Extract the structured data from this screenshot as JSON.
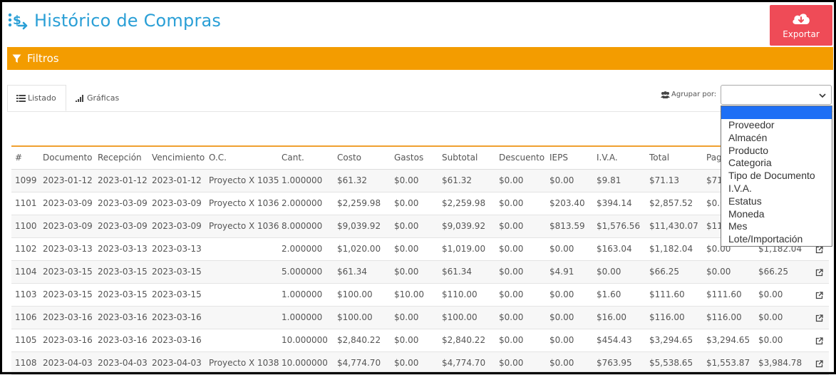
{
  "header": {
    "title": "Histórico de Compras",
    "export_label": "Exportar"
  },
  "filters": {
    "label": "Filtros"
  },
  "tabs": [
    {
      "label": "Listado"
    },
    {
      "label": "Gráficas"
    }
  ],
  "group_by": {
    "label": "Agrupar por:",
    "selected": "",
    "options": [
      "",
      "Proveedor",
      "Almacén",
      "Producto",
      "Categoria",
      "Tipo de Documento",
      "I.V.A.",
      "Estatus",
      "Moneda",
      "Mes",
      "Lote/Importación"
    ]
  },
  "table": {
    "columns": [
      "#",
      "Documento",
      "Recepción",
      "Vencimiento",
      "O.C.",
      "Cant.",
      "Costo",
      "Gastos",
      "Subtotal",
      "Descuento",
      "IEPS",
      "I.V.A.",
      "Total",
      "Pag",
      ""
    ],
    "rows": [
      [
        "1099",
        "2023-01-12",
        "2023-01-12",
        "2023-01-12",
        "Proyecto X 1035",
        "1.000000",
        "$61.32",
        "$0.00",
        "$61.32",
        "$0.00",
        "$0.00",
        "$9.81",
        "$71.13",
        "$71",
        ""
      ],
      [
        "1101",
        "2023-03-09",
        "2023-03-09",
        "2023-03-09",
        "Proyecto X 1036",
        "2.000000",
        "$2,259.98",
        "$0.00",
        "$2,259.98",
        "$0.00",
        "$203.40",
        "$394.14",
        "$2,857.52",
        "$0.0",
        ""
      ],
      [
        "1100",
        "2023-03-09",
        "2023-03-09",
        "2023-03-09",
        "Proyecto X 1036",
        "8.000000",
        "$9,039.92",
        "$0.00",
        "$9,039.92",
        "$0.00",
        "$813.59",
        "$1,576.56",
        "$11,430.07",
        "$11",
        ""
      ],
      [
        "1102",
        "2023-03-13",
        "2023-03-13",
        "2023-03-13",
        "",
        "2.000000",
        "$1,020.00",
        "$0.00",
        "$1,019.00",
        "$0.00",
        "$0.00",
        "$163.04",
        "$1,182.04",
        "$0.00",
        "$1,182.04"
      ],
      [
        "1104",
        "2023-03-15",
        "2023-03-15",
        "2023-03-15",
        "",
        "5.000000",
        "$61.34",
        "$0.00",
        "$61.34",
        "$0.00",
        "$4.91",
        "$0.00",
        "$66.25",
        "$0.00",
        "$66.25"
      ],
      [
        "1103",
        "2023-03-15",
        "2023-03-15",
        "2023-03-15",
        "",
        "1.000000",
        "$100.00",
        "$10.00",
        "$110.00",
        "$0.00",
        "$0.00",
        "$1.60",
        "$111.60",
        "$111.60",
        "$0.00"
      ],
      [
        "1106",
        "2023-03-16",
        "2023-03-16",
        "2023-03-16",
        "",
        "1.000000",
        "$100.00",
        "$0.00",
        "$100.00",
        "$0.00",
        "$0.00",
        "$16.00",
        "$116.00",
        "$116.00",
        "$0.00"
      ],
      [
        "1105",
        "2023-03-16",
        "2023-03-16",
        "2023-03-16",
        "",
        "10.000000",
        "$2,840.22",
        "$0.00",
        "$2,840.22",
        "$0.00",
        "$0.00",
        "$454.43",
        "$3,294.65",
        "$3,294.65",
        "$0.00"
      ],
      [
        "1108",
        "2023-04-03",
        "2023-04-03",
        "2023-04-03",
        "Proyecto X 1038",
        "10.000000",
        "$4,774.70",
        "$0.00",
        "$4,774.70",
        "$0.00",
        "$0.00",
        "$763.95",
        "$5,538.65",
        "$1,553.87",
        "$3,984.78"
      ]
    ]
  },
  "colors": {
    "title": "#2a9fd6",
    "export_bg": "#ef4b57",
    "filter_bar": "#f39c00",
    "dropdown_selected": "#1e6ff5"
  },
  "icons": {
    "logo": "sync-transfer-icon",
    "export": "cloud-download-icon",
    "filter": "funnel-icon",
    "list": "list-icon",
    "chart": "bar-chart-icon",
    "group": "users-icon",
    "row_action": "external-link-icon"
  }
}
